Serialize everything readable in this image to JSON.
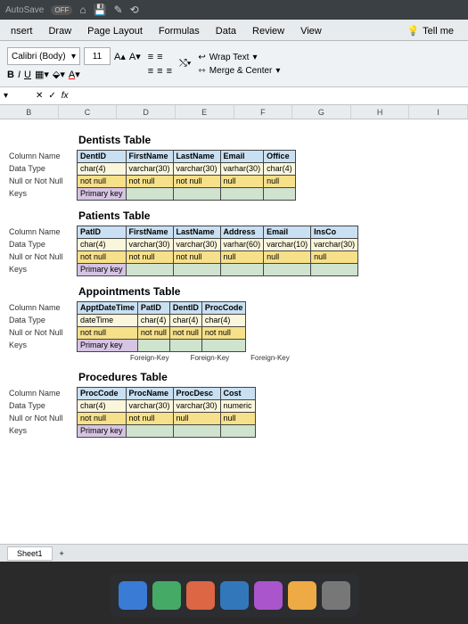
{
  "titlebar": {
    "autosave": "AutoSave",
    "off": "OFF"
  },
  "tabs": {
    "insert": "nsert",
    "draw": "Draw",
    "layout": "Page Layout",
    "formulas": "Formulas",
    "data": "Data",
    "review": "Review",
    "view": "View",
    "tell": "Tell me"
  },
  "ribbon": {
    "font": "Calibri (Body)",
    "size": "11",
    "wrap": "Wrap Text",
    "merge": "Merge & Center"
  },
  "formula": {
    "fx": "fx"
  },
  "cols": [
    "B",
    "C",
    "D",
    "E",
    "F",
    "G",
    "H",
    "I"
  ],
  "rowlabels": [
    "Column Name",
    "Data Type",
    "Null or Not Null",
    "Keys"
  ],
  "dentists": {
    "title": "Dentists Table",
    "cols": [
      {
        "name": "DentID",
        "type": "char(4)",
        "null": "not null",
        "key": "Primary key",
        "pk": true
      },
      {
        "name": "FirstName",
        "type": "varchar(30)",
        "null": "not null",
        "key": ""
      },
      {
        "name": "LastName",
        "type": "varchar(30)",
        "null": "not null",
        "key": ""
      },
      {
        "name": "Email",
        "type": "varhar(30)",
        "null": "null",
        "key": ""
      },
      {
        "name": "Office",
        "type": "char(4)",
        "null": "null",
        "key": ""
      }
    ]
  },
  "patients": {
    "title": "Patients Table",
    "cols": [
      {
        "name": "PatID",
        "type": "char(4)",
        "null": "not null",
        "key": "Primary key",
        "pk": true
      },
      {
        "name": "FirstName",
        "type": "varchar(30)",
        "null": "not null",
        "key": ""
      },
      {
        "name": "LastName",
        "type": "varchar(30)",
        "null": "not null",
        "key": ""
      },
      {
        "name": "Address",
        "type": "varhar(60)",
        "null": "null",
        "key": ""
      },
      {
        "name": "Email",
        "type": "varchar(10)",
        "null": "null",
        "key": ""
      },
      {
        "name": "InsCo",
        "type": "varchar(30)",
        "null": "null",
        "key": ""
      }
    ]
  },
  "appts": {
    "title": "Appointments Table",
    "cols": [
      {
        "name": "ApptDateTime",
        "type": "dateTime",
        "null": "not null",
        "key": "Primary key",
        "pk": true
      },
      {
        "name": "PatID",
        "type": "char(4)",
        "null": "not null",
        "key": ""
      },
      {
        "name": "DentID",
        "type": "char(4)",
        "null": "not null",
        "key": ""
      },
      {
        "name": "ProcCode",
        "type": "char(4)",
        "null": "not null",
        "key": ""
      }
    ],
    "fk": [
      "Foreign-Key",
      "Foreign-Key",
      "Foreign-Key"
    ]
  },
  "procs": {
    "title": "Procedures Table",
    "cols": [
      {
        "name": "ProcCode",
        "type": "char(4)",
        "null": "not null",
        "key": "Primary key",
        "pk": true
      },
      {
        "name": "ProcName",
        "type": "varchar(30)",
        "null": "not null",
        "key": ""
      },
      {
        "name": "ProcDesc",
        "type": "varchar(30)",
        "null": "null",
        "key": ""
      },
      {
        "name": "Cost",
        "type": "numeric",
        "null": "null",
        "key": ""
      }
    ]
  },
  "sheettab": "Sheet1"
}
